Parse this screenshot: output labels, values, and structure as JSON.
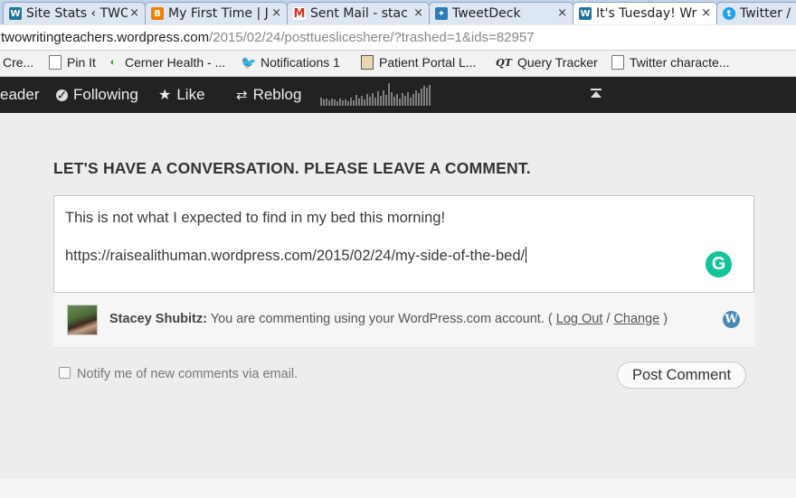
{
  "tabs": [
    {
      "title": "Site Stats ‹ TWO",
      "icon": "wordpress-icon",
      "active": false
    },
    {
      "title": "My First Time | J",
      "icon": "blogger-icon",
      "active": false
    },
    {
      "title": "Sent Mail - stac",
      "icon": "gmail-icon",
      "active": false
    },
    {
      "title": "TweetDeck",
      "icon": "tweetdeck-icon",
      "active": false
    },
    {
      "title": "It's Tuesday! Wr",
      "icon": "wordpress-icon",
      "active": true
    },
    {
      "title": "Twitter /",
      "icon": "twitter-icon",
      "active": false
    }
  ],
  "tab_close_glyph": "×",
  "address": {
    "host": "twowritingteachers.wordpress.com",
    "path": "/2015/02/24/posttuesliceshere/?trashed=1&ids=82957"
  },
  "bookmarks": [
    {
      "label": "Cre...",
      "icon": "none"
    },
    {
      "label": "Pin It",
      "icon": "page-icon"
    },
    {
      "label": "Cerner Health - ...",
      "icon": "cerner-icon"
    },
    {
      "label": "Notifications 1",
      "icon": "twitter-icon"
    },
    {
      "label": "Patient Portal L...",
      "icon": "portal-icon"
    },
    {
      "label": "Query Tracker",
      "icon": "qt-icon"
    },
    {
      "label": "Twitter characte...",
      "icon": "page-icon"
    }
  ],
  "wp_toolbar": {
    "reader": "eader",
    "following": "Following",
    "like": "Like",
    "reblog": "Reblog"
  },
  "comment_form": {
    "heading": "LET'S HAVE A CONVERSATION. PLEASE LEAVE A COMMENT.",
    "text_line1": "This is not what I expected to find in my bed this morning!",
    "text_line2": "https://raisealithuman.wordpress.com/2015/02/24/my-side-of-the-bed/",
    "grammarly_letter": "G",
    "user_name": "Stacey Shubitz:",
    "account_note": " You are commenting using your WordPress.com account. ( ",
    "logout": "Log Out",
    "sep": " / ",
    "change": "Change",
    "close_paren": " )",
    "notify_label": "Notify me of new comments via email.",
    "post_button": "Post Comment"
  }
}
